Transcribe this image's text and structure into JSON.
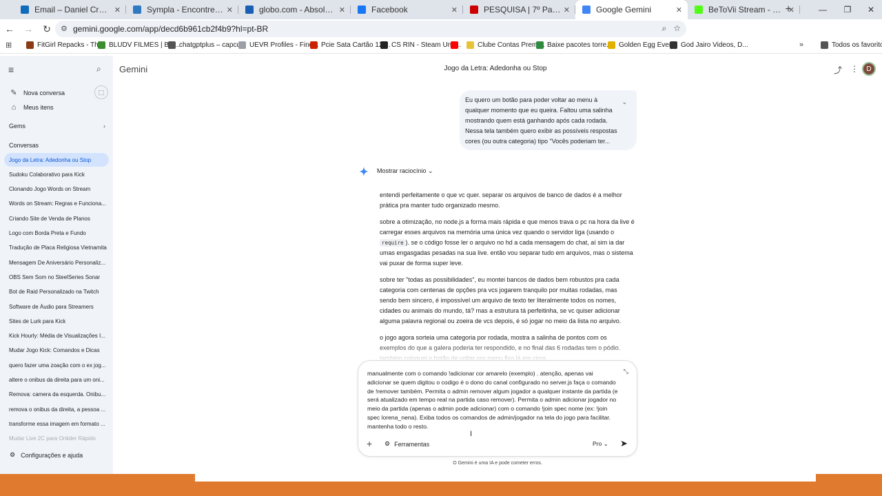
{
  "tabs": [
    {
      "label": "Email – Daniel Cruz – Outlook",
      "color": "#0f6cbd",
      "active": false
    },
    {
      "label": "Sympla - Encontre os melhores eventos",
      "color": "#2f78c4",
      "active": false
    },
    {
      "label": "globo.com - Absolutamente tudo",
      "color": "#1a5fb4",
      "active": false
    },
    {
      "label": "Facebook",
      "color": "#1877f2",
      "active": false
    },
    {
      "label": "PESQUISA | 7º Paredão - Quem",
      "color": "#cc0000",
      "active": false
    },
    {
      "label": "Google Gemini",
      "color": "#4285f4",
      "active": true
    },
    {
      "label": "BeToVii Stream - Watch Live on",
      "color": "#53fc18",
      "active": false
    }
  ],
  "browser": {
    "url": "gemini.google.com/app/decd6b961cb2f4b9?hl=pt-BR",
    "new_tab": "+",
    "minimize": "—",
    "maximize": "❐",
    "close": "✕"
  },
  "bookmarks": [
    {
      "label": "FitGirl Repacks - Th...",
      "color": "#8a3b14"
    },
    {
      "label": "BLUDV FILMES | Bai...",
      "color": "#3c8d2f"
    },
    {
      "label": "chatgptplus – capcu...",
      "color": "#555555"
    },
    {
      "label": "UEVR Profiles - Find...",
      "color": "#9aa0a6"
    },
    {
      "label": "Pcie Sata Cartão 12/...",
      "color": "#cc2200"
    },
    {
      "label": "CS RIN - Steam Und...",
      "color": "#222222"
    },
    {
      "label": "",
      "color": "#ff0000"
    },
    {
      "label": "Clube Contas Premi...",
      "color": "#e8c33a"
    },
    {
      "label": "Baixe pacotes torre...",
      "color": "#2d8a3e"
    },
    {
      "label": "Golden Egg Event",
      "color": "#e2b100"
    },
    {
      "label": "God Jairo Videos, D...",
      "color": "#333333"
    },
    {
      "label": "Todos os favoritos",
      "color": "#555555"
    }
  ],
  "sidebar": {
    "new_chat": "Nova conversa",
    "my_items": "Meus itens",
    "gems": "Gems",
    "conversations_heading": "Conversas",
    "conversations": [
      "Jogo da Letra: Adedonha ou Stop",
      "Sudoku Colaborativo para Kick",
      "Clonando Jogo Words on Stream",
      "Words on Stream: Regras e Funciona...",
      "Criando Site de Venda de Planos",
      "Logo com Borda Preta e Fundo",
      "Tradução de Placa Religiosa Vietnamita",
      "Mensagem De Aniversário Personaliz...",
      "OBS Sem Som no SteelSeries Sonar",
      "Bot de Raid Personalizado na Twitch",
      "Software de Áudio para Streamers",
      "Sites de Lurk para Kick",
      "Kick Hourly: Média de Visualizações I...",
      "Mudar Jogo Kick: Comandos e Dicas",
      "quero fazer uma zoação com o ex jog...",
      "altere o onibus da direita para um oni...",
      "Remova: camera da esquerda. Onibu...",
      "remova o onibus da direita, a pessoa ...",
      "transforme essa imagem em formato ...",
      "Mudar Live 2C para Onlider Rápido"
    ],
    "settings": "Configurações e ajuda"
  },
  "header": {
    "app_name": "Gemini",
    "chat_title": "Jogo da Letra: Adedonha ou Stop",
    "avatar_letter": "D"
  },
  "user_message": "Eu quero um botão para poder voltar ao menu à qualquer momento que eu queira. Faltou uma salinha mostrando quem está ganhando após cada rodada. Nessa tela também quero exibir as possíveis respostas cores (ou outra categoria) tipo \"Vocês poderiam ter...",
  "reasoning_label": "Mostrar raciocínio",
  "response": {
    "p1": "entendi perfeitamente o que vc quer. separar os arquivos de banco de dados é a melhor prática pra manter tudo organizado mesmo.",
    "p2_a": "sobre a otimização, no node.js a forma mais rápida e que menos trava o pc na hora da live é carregar esses arquivos na memória uma única vez quando o servidor liga (usando o",
    "p2_code": "require",
    "p2_b": "). se o código fosse ler o arquivo no hd a cada mensagem do chat, aí sim ia dar umas engasgadas pesadas na sua live. então vou separar tudo em arquivos, mas o sistema vai puxar de forma super leve.",
    "p3": "sobre ter \"todas as possibilidades\", eu montei bancos de dados bem robustos pra cada categoria com centenas de opções pra vcs jogarem tranquilo por muitas rodadas, mas sendo bem sincero, é impossível um arquivo de texto ter literalmente todos os nomes, cidades ou animais do mundo, tá? mas a estrutura tá perfeitinha, se vc quiser adicionar alguma palavra regional ou zoeira de vcs depois, é só jogar no meio da lista no arquivo.",
    "p4": "o jogo agora sorteia uma categoria por rodada, mostra a salinha de pontos com os exemplos do que a galera poderia ter respondido, e no final das 6 rodadas tem o pódio. também coloquei o botão de voltar pro menu fixo lá em cima."
  },
  "input": {
    "text": "manualmente com o comando !adicionar cor amarelo  (exemplo) . atenção, apenas vai adicionar se quem digitou o codigo é o dono do canal configurado no server.js   faça o comando de !remover também. Permita o admin remover algum jogador a qualquer instante da partida (e será atualizado em tempo real na partida caso remover).  Permita o admin adicionar jogador no meio da partida (apenas o admin pode adicionar) com o comando !join spec nome  (ex: !join spec lorena_nena).   Exiba todos os comandos de admin/jogador na tela do jogo para facilitar. mantenha todo o resto.",
    "tools_label": "Ferramentas",
    "model_label": "Pro"
  },
  "disclaimer": "O Gemini é uma IA e pode cometer erros.",
  "icons": {
    "menu": "menu-icon",
    "search": "search-icon",
    "new_chat": "edit-icon",
    "my_items": "library-icon",
    "settings": "gear-icon",
    "share": "share-icon",
    "more": "more-vert-icon",
    "send": "send-icon",
    "plus": "plus-icon",
    "tools": "tools-icon",
    "sparkle": "sparkle-icon"
  },
  "colors": {
    "sidebar_bg": "#f0f4f9",
    "active_conv_bg": "#d3e3fd",
    "user_bubble_bg": "#f0f4f9",
    "taskbar": "#e07a2e",
    "tab_strip": "#dfe3ea"
  }
}
